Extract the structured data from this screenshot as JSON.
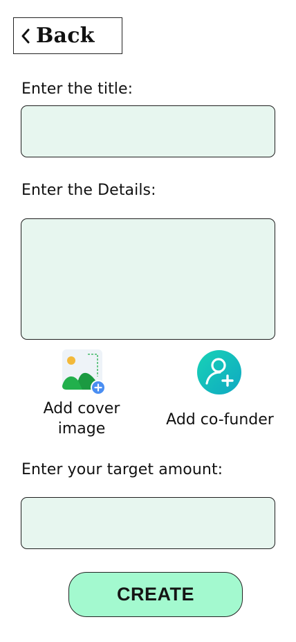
{
  "header": {
    "back_label": "Back",
    "back_icon": "chevron-left-icon"
  },
  "form": {
    "title_label": "Enter the title:",
    "title_value": "",
    "details_label": "Enter the Details:",
    "details_value": "",
    "amount_label": "Enter your target amount:",
    "amount_value": ""
  },
  "actions": {
    "cover": {
      "label_line1": "Add cover",
      "label_line2": "image",
      "icon": "add-image-icon"
    },
    "cofunder": {
      "label": "Add co-funder",
      "icon": "add-user-icon"
    }
  },
  "submit": {
    "label": "CREATE"
  },
  "colors": {
    "input_bg": "#e7f6ef",
    "button_bg": "#a3f9cf",
    "cofunder_icon_teal": "#14c8b4",
    "add_badge_blue": "#4a8ef2",
    "image_icon_green": "#22b04c",
    "image_icon_sun": "#f3b93a"
  }
}
